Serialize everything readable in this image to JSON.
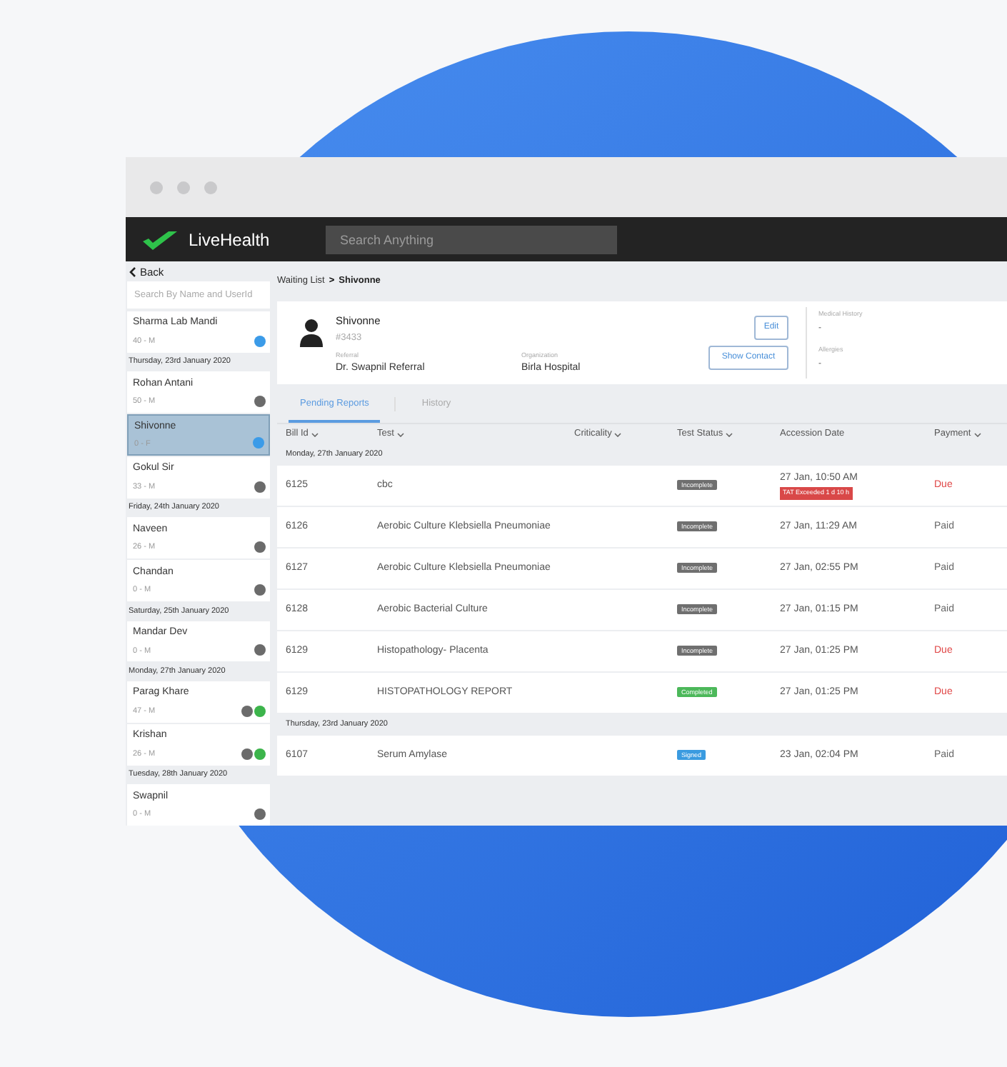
{
  "window": {
    "controls": [
      {
        "kind": "dot"
      },
      {
        "kind": "dot"
      },
      {
        "kind": "dot"
      }
    ]
  },
  "app": {
    "logo": "LiveHealth",
    "search": {
      "placeholder": "Search Anything"
    }
  },
  "sidebar": {
    "back": "Back",
    "search": {
      "placeholder": "Search By Name and UserId"
    },
    "items": [
      {
        "kind": "patient",
        "name": "Sharma Lab Mandi",
        "meta": "40 - M",
        "selected": false,
        "badges": [
          {
            "color": "#3b9be8"
          }
        ]
      },
      {
        "kind": "date",
        "label": "Thursday, 23rd January 2020"
      },
      {
        "kind": "patient",
        "name": "Rohan Antani",
        "meta": "50 - M",
        "selected": false,
        "badges": [
          {
            "color": "#6b6b6b"
          }
        ]
      },
      {
        "kind": "patient",
        "name": "Shivonne",
        "meta": "0 - F",
        "selected": true,
        "badges": [
          {
            "color": "#3b9be8"
          }
        ]
      },
      {
        "kind": "patient",
        "name": "Gokul Sir",
        "meta": "33 - M",
        "selected": false,
        "badges": [
          {
            "color": "#6b6b6b"
          }
        ]
      },
      {
        "kind": "date",
        "label": "Friday, 24th January 2020"
      },
      {
        "kind": "patient",
        "name": "Naveen",
        "meta": "26 - M",
        "selected": false,
        "badges": [
          {
            "color": "#6b6b6b"
          }
        ]
      },
      {
        "kind": "patient",
        "name": "Chandan",
        "meta": "0 - M",
        "selected": false,
        "badges": [
          {
            "color": "#6b6b6b"
          }
        ]
      },
      {
        "kind": "date",
        "label": "Saturday, 25th January 2020"
      },
      {
        "kind": "patient",
        "name": "Mandar Dev",
        "meta": "0 - M",
        "selected": false,
        "badges": [
          {
            "color": "#6b6b6b"
          }
        ]
      },
      {
        "kind": "date",
        "label": "Monday, 27th January 2020"
      },
      {
        "kind": "patient",
        "name": "Parag Khare",
        "meta": "47 - M",
        "selected": false,
        "badges": [
          {
            "color": "#6b6b6b"
          },
          {
            "color": "#3cb44b"
          }
        ]
      },
      {
        "kind": "patient",
        "name": "Krishan",
        "meta": "26 - M",
        "selected": false,
        "badges": [
          {
            "color": "#6b6b6b"
          },
          {
            "color": "#3cb44b"
          }
        ]
      },
      {
        "kind": "date",
        "label": "Tuesday, 28th January 2020"
      },
      {
        "kind": "patient",
        "name": "Swapnil",
        "meta": "0 - M",
        "selected": false,
        "badges": [
          {
            "color": "#6b6b6b"
          }
        ]
      }
    ]
  },
  "breadcrumb": {
    "parent": "Waiting List",
    "separator": ">",
    "current": "Shivonne"
  },
  "patient": {
    "name": "Shivonne",
    "id": "#3433",
    "referral_label": "Referral",
    "referral": "Dr. Swapnil Referral",
    "organization_label": "Organization",
    "organization": "Birla Hospital",
    "edit_button": "Edit",
    "contact_button": "Show Contact",
    "medical_history_label": "Medical History",
    "medical_history": "-",
    "allergies_label": "Allergies",
    "allergies": "-"
  },
  "tabs": [
    {
      "label": "Pending Reports",
      "selected": true
    },
    {
      "label": "History",
      "selected": false
    }
  ],
  "table": {
    "columns": [
      {
        "label": "Bill Id",
        "sortable": true
      },
      {
        "label": "Test",
        "sortable": true
      },
      {
        "label": "Criticality",
        "sortable": true
      },
      {
        "label": "Test Status",
        "sortable": true
      },
      {
        "label": "Accession Date",
        "sortable": false
      },
      {
        "label": "Payment",
        "sortable": true
      }
    ],
    "groups": [
      {
        "date": "Monday, 27th January 2020",
        "rows": [
          {
            "bill_id": "6125",
            "test": "cbc",
            "status": {
              "label": "Incomplete",
              "kind": "incomplete"
            },
            "date": "27 Jan, 10:50 AM",
            "alert": "TAT Exceeded 1 d 10 h",
            "payment": {
              "label": "Due",
              "kind": "due"
            }
          },
          {
            "bill_id": "6126",
            "test": "Aerobic Culture Klebsiella Pneumoniae",
            "status": {
              "label": "Incomplete",
              "kind": "incomplete"
            },
            "date": "27 Jan, 11:29 AM",
            "payment": {
              "label": "Paid",
              "kind": "paid"
            }
          },
          {
            "bill_id": "6127",
            "test": "Aerobic Culture Klebsiella Pneumoniae",
            "status": {
              "label": "Incomplete",
              "kind": "incomplete"
            },
            "date": "27 Jan, 02:55 PM",
            "payment": {
              "label": "Paid",
              "kind": "paid"
            }
          },
          {
            "bill_id": "6128",
            "test": "Aerobic Bacterial Culture",
            "status": {
              "label": "Incomplete",
              "kind": "incomplete"
            },
            "date": "27 Jan, 01:15 PM",
            "payment": {
              "label": "Paid",
              "kind": "paid"
            }
          },
          {
            "bill_id": "6129",
            "test": "Histopathology- Placenta",
            "status": {
              "label": "Incomplete",
              "kind": "incomplete"
            },
            "date": "27 Jan, 01:25 PM",
            "payment": {
              "label": "Due",
              "kind": "due"
            }
          },
          {
            "bill_id": "6129",
            "test": "HISTOPATHOLOGY REPORT",
            "status": {
              "label": "Completed",
              "kind": "completed"
            },
            "date": "27 Jan, 01:25 PM",
            "payment": {
              "label": "Due",
              "kind": "due"
            }
          }
        ]
      },
      {
        "date": "Thursday, 23rd January 2020",
        "rows": [
          {
            "bill_id": "6107",
            "test": "Serum Amylase",
            "status": {
              "label": "Signed",
              "kind": "signed"
            },
            "date": "23 Jan, 02:04 PM",
            "payment": {
              "label": "Paid",
              "kind": "paid"
            }
          }
        ]
      }
    ]
  }
}
